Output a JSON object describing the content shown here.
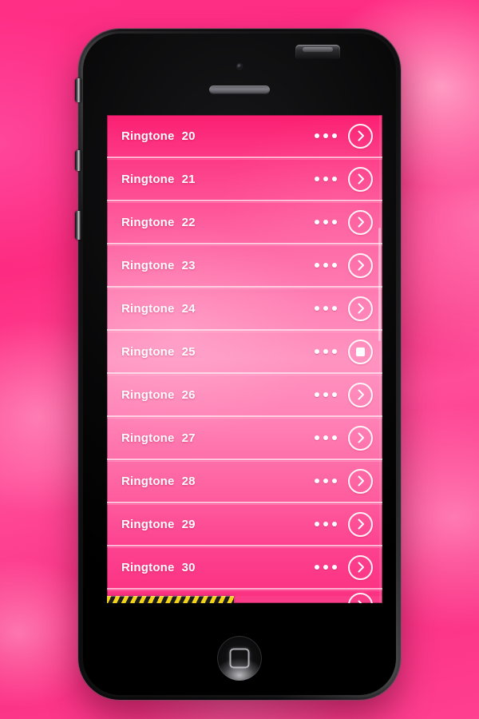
{
  "wallpaper": {
    "description": "pink watercolor smoke",
    "base_color": "#fc2a7e",
    "highlight_color": "#ffb6d4"
  },
  "device": {
    "name": "smartphone-mockup",
    "body_color": "#0a0a0b",
    "buttons": {
      "power": "power-button",
      "silent_switch": "silent-switch",
      "volume_up": "volume-up-button",
      "volume_down": "volume-down-button",
      "home": "home-button"
    }
  },
  "app": {
    "accent_color": "#ff3f90",
    "list": {
      "scroll_percent": 23,
      "rows": [
        {
          "title": "Ringtone",
          "number": "20",
          "action": "play-icon",
          "playing": false
        },
        {
          "title": "Ringtone",
          "number": "21",
          "action": "play-icon",
          "playing": false
        },
        {
          "title": "Ringtone",
          "number": "22",
          "action": "play-icon",
          "playing": false
        },
        {
          "title": "Ringtone",
          "number": "23",
          "action": "play-icon",
          "playing": false
        },
        {
          "title": "Ringtone",
          "number": "24",
          "action": "play-icon",
          "playing": false
        },
        {
          "title": "Ringtone",
          "number": "25",
          "action": "stop-icon",
          "playing": true
        },
        {
          "title": "Ringtone",
          "number": "26",
          "action": "play-icon",
          "playing": false
        },
        {
          "title": "Ringtone",
          "number": "27",
          "action": "play-icon",
          "playing": false
        },
        {
          "title": "Ringtone",
          "number": "28",
          "action": "play-icon",
          "playing": false
        },
        {
          "title": "Ringtone",
          "number": "29",
          "action": "play-icon",
          "playing": false
        },
        {
          "title": "Ringtone",
          "number": "30",
          "action": "play-icon",
          "playing": false
        }
      ],
      "overflow_icon": "more-options-icon"
    },
    "progress_bar": {
      "name": "playback-progress-bar",
      "percent": 46,
      "stripe_color": "#f2d21a",
      "stripe_alt_color": "#1b1b1b"
    }
  }
}
